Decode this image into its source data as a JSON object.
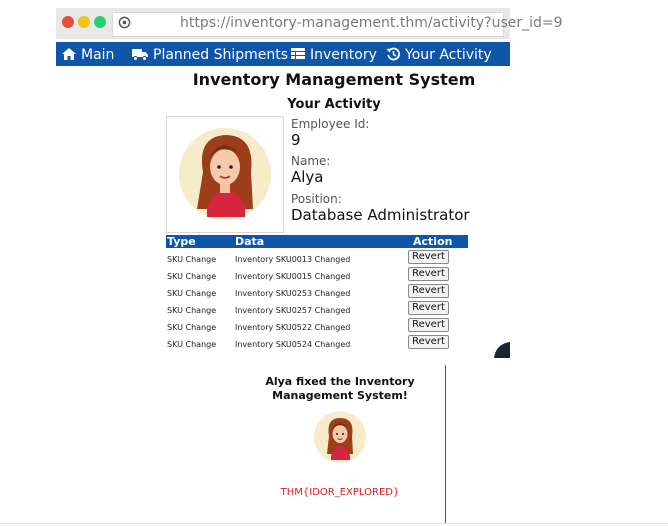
{
  "browser": {
    "url": "https://inventory-management.thm/activity?user_id=9",
    "traffic_colors": [
      "#e74c3c",
      "#f1c40f",
      "#2ecc71"
    ]
  },
  "nav": {
    "items": [
      {
        "label": "Main",
        "icon": "home-icon"
      },
      {
        "label": "Planned Shipments",
        "icon": "truck-icon"
      },
      {
        "label": "Inventory",
        "icon": "table-icon"
      },
      {
        "label": "Your Activity",
        "icon": "history-icon"
      }
    ],
    "bar_color": "#0f56a8"
  },
  "page": {
    "title": "Inventory Management System",
    "subtitle": "Your Activity"
  },
  "profile": {
    "employee_id_label": "Employee Id:",
    "employee_id": "9",
    "name_label": "Name:",
    "name": "Alya",
    "position_label": "Position:",
    "position": "Database Administrator"
  },
  "table": {
    "headers": {
      "type": "Type",
      "data": "Data",
      "action": "Action"
    },
    "rows": [
      {
        "type": "SKU Change",
        "data": "Inventory SKU0013 Changed",
        "action": "Revert"
      },
      {
        "type": "SKU Change",
        "data": "Inventory SKU0015 Changed",
        "action": "Revert"
      },
      {
        "type": "SKU Change",
        "data": "Inventory SKU0253 Changed",
        "action": "Revert"
      },
      {
        "type": "SKU Change",
        "data": "Inventory SKU0257 Changed",
        "action": "Revert"
      },
      {
        "type": "SKU Change",
        "data": "Inventory SKU0522 Changed",
        "action": "Revert"
      },
      {
        "type": "SKU Change",
        "data": "Inventory SKU0524 Changed",
        "action": "Revert"
      }
    ]
  },
  "result": {
    "message": "Alya fixed the Inventory Management System!",
    "flag": "THM{IDOR_EXPLORED}",
    "flag_color": "#d42020"
  }
}
